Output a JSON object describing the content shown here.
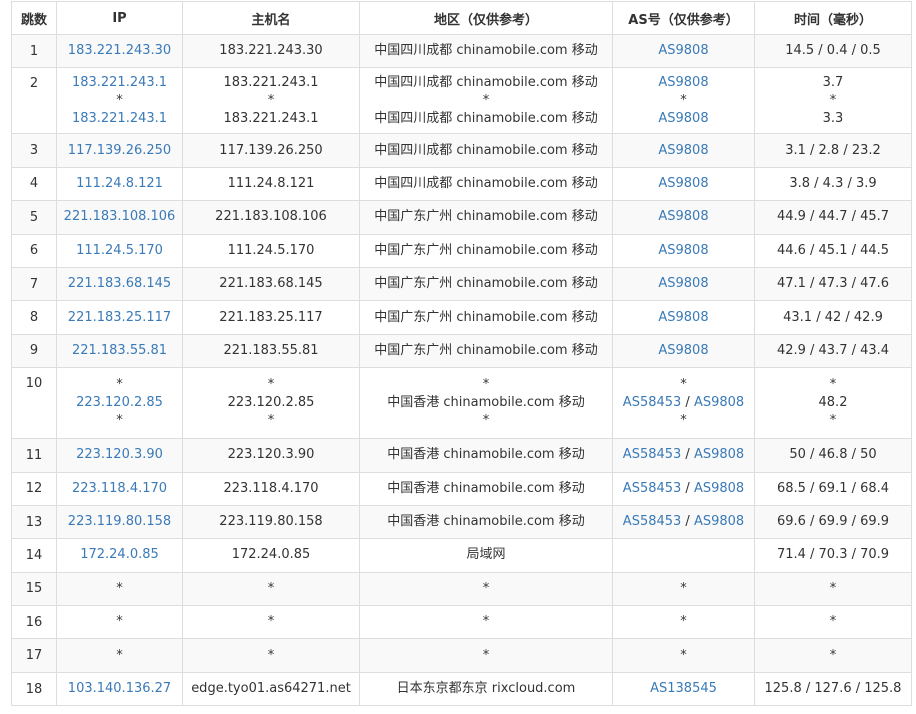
{
  "headers": [
    "跳数",
    "IP",
    "主机名",
    "地区（仅供参考）",
    "AS号（仅供参考）",
    "时间（毫秒）"
  ],
  "rows": [
    {
      "hop": "1",
      "ip": [
        "183.221.243.30"
      ],
      "host": [
        "183.221.243.30"
      ],
      "region": [
        "中国四川成都 chinamobile.com 移动"
      ],
      "as": [
        [
          "AS9808"
        ]
      ],
      "time": [
        "14.5 / 0.4 / 0.5"
      ]
    },
    {
      "hop": "2",
      "ip": [
        "183.221.243.1",
        "*",
        "183.221.243.1"
      ],
      "host": [
        "183.221.243.1",
        "*",
        "183.221.243.1"
      ],
      "region": [
        "中国四川成都 chinamobile.com 移动",
        "*",
        "中国四川成都 chinamobile.com 移动"
      ],
      "as": [
        [
          "AS9808"
        ],
        [
          "*"
        ],
        [
          "AS9808"
        ]
      ],
      "time": [
        "3.7",
        "*",
        "3.3"
      ]
    },
    {
      "hop": "3",
      "ip": [
        "117.139.26.250"
      ],
      "host": [
        "117.139.26.250"
      ],
      "region": [
        "中国四川成都 chinamobile.com 移动"
      ],
      "as": [
        [
          "AS9808"
        ]
      ],
      "time": [
        "3.1 / 2.8 / 23.2"
      ]
    },
    {
      "hop": "4",
      "ip": [
        "111.24.8.121"
      ],
      "host": [
        "111.24.8.121"
      ],
      "region": [
        "中国四川成都 chinamobile.com 移动"
      ],
      "as": [
        [
          "AS9808"
        ]
      ],
      "time": [
        "3.8 / 4.3 / 3.9"
      ]
    },
    {
      "hop": "5",
      "ip": [
        "221.183.108.106"
      ],
      "host": [
        "221.183.108.106"
      ],
      "region": [
        "中国广东广州 chinamobile.com 移动"
      ],
      "as": [
        [
          "AS9808"
        ]
      ],
      "time": [
        "44.9 / 44.7 / 45.7"
      ]
    },
    {
      "hop": "6",
      "ip": [
        "111.24.5.170"
      ],
      "host": [
        "111.24.5.170"
      ],
      "region": [
        "中国广东广州 chinamobile.com 移动"
      ],
      "as": [
        [
          "AS9808"
        ]
      ],
      "time": [
        "44.6 / 45.1 / 44.5"
      ]
    },
    {
      "hop": "7",
      "ip": [
        "221.183.68.145"
      ],
      "host": [
        "221.183.68.145"
      ],
      "region": [
        "中国广东广州 chinamobile.com 移动"
      ],
      "as": [
        [
          "AS9808"
        ]
      ],
      "time": [
        "47.1 / 47.3 / 47.6"
      ]
    },
    {
      "hop": "8",
      "ip": [
        "221.183.25.117"
      ],
      "host": [
        "221.183.25.117"
      ],
      "region": [
        "中国广东广州 chinamobile.com 移动"
      ],
      "as": [
        [
          "AS9808"
        ]
      ],
      "time": [
        "43.1 / 42 / 42.9"
      ]
    },
    {
      "hop": "9",
      "ip": [
        "221.183.55.81"
      ],
      "host": [
        "221.183.55.81"
      ],
      "region": [
        "中国广东广州 chinamobile.com 移动"
      ],
      "as": [
        [
          "AS9808"
        ]
      ],
      "time": [
        "42.9 / 43.7 / 43.4"
      ]
    },
    {
      "hop": "10",
      "ip": [
        "*",
        "223.120.2.85",
        "*"
      ],
      "host": [
        "*",
        "223.120.2.85",
        "*"
      ],
      "region": [
        "*",
        "中国香港 chinamobile.com 移动",
        "*"
      ],
      "as": [
        [
          "*"
        ],
        [
          "AS58453",
          "AS9808"
        ],
        [
          "*"
        ]
      ],
      "time": [
        "*",
        "48.2",
        "*"
      ]
    },
    {
      "hop": "11",
      "ip": [
        "223.120.3.90"
      ],
      "host": [
        "223.120.3.90"
      ],
      "region": [
        "中国香港 chinamobile.com 移动"
      ],
      "as": [
        [
          "AS58453",
          "AS9808"
        ]
      ],
      "time": [
        "50 / 46.8 / 50"
      ]
    },
    {
      "hop": "12",
      "ip": [
        "223.118.4.170"
      ],
      "host": [
        "223.118.4.170"
      ],
      "region": [
        "中国香港 chinamobile.com 移动"
      ],
      "as": [
        [
          "AS58453",
          "AS9808"
        ]
      ],
      "time": [
        "68.5 / 69.1 / 68.4"
      ]
    },
    {
      "hop": "13",
      "ip": [
        "223.119.80.158"
      ],
      "host": [
        "223.119.80.158"
      ],
      "region": [
        "中国香港 chinamobile.com 移动"
      ],
      "as": [
        [
          "AS58453",
          "AS9808"
        ]
      ],
      "time": [
        "69.6 / 69.9 / 69.9"
      ]
    },
    {
      "hop": "14",
      "ip": [
        "172.24.0.85"
      ],
      "host": [
        "172.24.0.85"
      ],
      "region": [
        "局域网"
      ],
      "as": [
        []
      ],
      "time": [
        "71.4 / 70.3 / 70.9"
      ]
    },
    {
      "hop": "15",
      "ip": [
        "*"
      ],
      "host": [
        "*"
      ],
      "region": [
        "*"
      ],
      "as": [
        [
          "*"
        ]
      ],
      "time": [
        "*"
      ]
    },
    {
      "hop": "16",
      "ip": [
        "*"
      ],
      "host": [
        "*"
      ],
      "region": [
        "*"
      ],
      "as": [
        [
          "*"
        ]
      ],
      "time": [
        "*"
      ]
    },
    {
      "hop": "17",
      "ip": [
        "*"
      ],
      "host": [
        "*"
      ],
      "region": [
        "*"
      ],
      "as": [
        [
          "*"
        ]
      ],
      "time": [
        "*"
      ]
    },
    {
      "hop": "18",
      "ip": [
        "103.140.136.27"
      ],
      "host": [
        "edge.tyo01.as64271.net"
      ],
      "region": [
        "日本东京都东京 rixcloud.com"
      ],
      "as": [
        [
          "AS138545"
        ]
      ],
      "time": [
        "125.8 / 127.6 / 125.8"
      ]
    }
  ],
  "as_separator": " / ",
  "colors": {
    "link": "#3a7ab7",
    "text": "#333333",
    "border": "#dddddd",
    "stripe": "#f9f9f9"
  }
}
